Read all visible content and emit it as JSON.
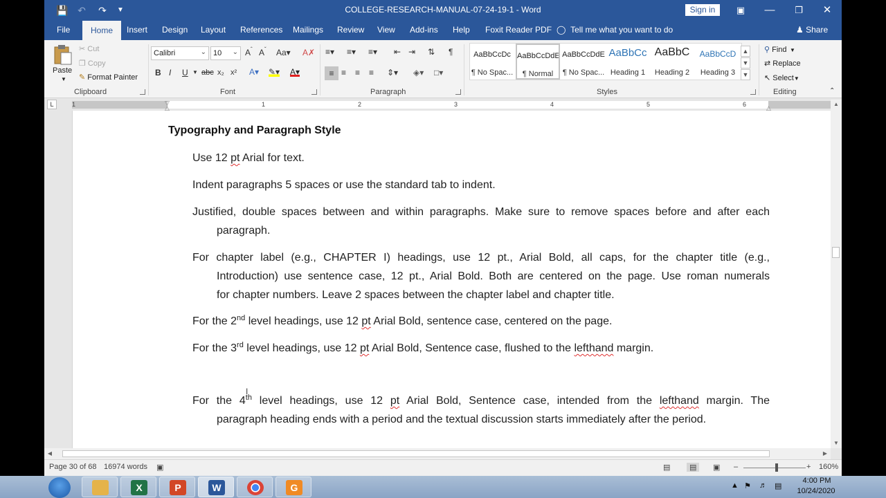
{
  "app": {
    "title": "COLLEGE-RESEARCH-MANUAL-07-24-19-1  -  Word",
    "sign_in": "Sign in"
  },
  "tabs": [
    "File",
    "Home",
    "Insert",
    "Design",
    "Layout",
    "References",
    "Mailings",
    "Review",
    "View",
    "Add-ins",
    "Help",
    "Foxit Reader PDF"
  ],
  "tell_me": "Tell me what you want to do",
  "share": "Share",
  "clipboard": {
    "paste": "Paste",
    "cut": "Cut",
    "copy": "Copy",
    "format_painter": "Format Painter",
    "label": "Clipboard"
  },
  "font": {
    "name": "Calibri",
    "size": "10",
    "label": "Font"
  },
  "paragraph": {
    "label": "Paragraph"
  },
  "styles": {
    "label": "Styles",
    "items": [
      {
        "sample": "AaBbCcDc",
        "name": "¶ No Spac..."
      },
      {
        "sample": "AaBbCcDdE",
        "name": "¶ Normal"
      },
      {
        "sample": "AaBbCcDdE",
        "name": "¶ No Spac..."
      },
      {
        "sample": "AaBbCc",
        "name": "Heading 1"
      },
      {
        "sample": "AaBbC",
        "name": "Heading 2"
      },
      {
        "sample": "AaBbCcD",
        "name": "Heading 3"
      }
    ]
  },
  "editing": {
    "find": "Find",
    "replace": "Replace",
    "select": "Select",
    "label": "Editing"
  },
  "ruler": {
    "numbers": [
      "1",
      "1",
      "2",
      "3",
      "4",
      "5",
      "6"
    ]
  },
  "document": {
    "heading": "Typography and Paragraph Style",
    "p1": {
      "a": "Use 12 ",
      "pt": "pt",
      "b": " Arial for text."
    },
    "p2": "Indent paragraphs 5 spaces or use the standard tab to indent.",
    "p3": {
      "l1": "Justified, double spaces between and within paragraphs. Make sure to remove spaces before and after each",
      "l2": "paragraph."
    },
    "p4": {
      "l1": "For chapter label (e.g., CHAPTER I) headings, use 12 pt., Arial Bold, all caps, for the chapter title (e.g.,",
      "l2": "Introduction) use sentence case, 12 pt., Arial Bold. Both are centered on the page. Use roman numerals",
      "l3": "for chapter numbers. Leave 2 spaces between the chapter label and chapter title."
    },
    "p5": {
      "a": "For the 2",
      "sup": "nd",
      "b": " level headings, use 12 ",
      "pt": "pt",
      "c": " Arial Bold, sentence case, centered on the page."
    },
    "p6": {
      "a": "For the 3",
      "sup": "rd",
      "b": " level headings, use 12 ",
      "pt": "pt",
      "c": " Arial Bold, Sentence case, flushed to the ",
      "lh": "lefthand",
      "d": " margin."
    },
    "p7": {
      "a": "For the 4",
      "sup": "th",
      "b": " level headings, use 12 ",
      "pt": "pt",
      "c": " Arial Bold, Sentence case, intended from the ",
      "lh": "lefthand",
      "d": " margin. The",
      "l2": "paragraph heading ends with a period and the textual discussion starts immediately after the period."
    }
  },
  "status": {
    "page": "Page 30 of 68",
    "words": "16974 words",
    "zoom": "160%"
  },
  "clock": {
    "time": "4:00 PM",
    "date": "10/24/2020"
  }
}
